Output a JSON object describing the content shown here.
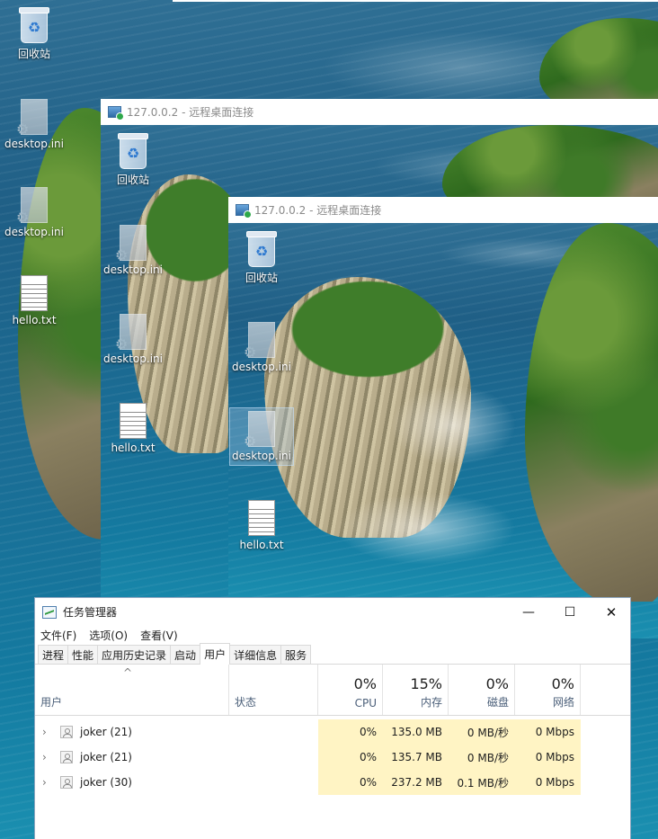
{
  "desktop": {
    "icons": [
      {
        "label": "回收站",
        "type": "recycle-bin"
      },
      {
        "label": "desktop.ini",
        "type": "ini-file"
      },
      {
        "label": "desktop.ini",
        "type": "ini-file"
      },
      {
        "label": "hello.txt",
        "type": "text-file"
      }
    ]
  },
  "rdp1": {
    "title": "127.0.0.2 - 远程桌面连接",
    "icons": [
      {
        "label": "回收站"
      },
      {
        "label": "desktop.ini"
      },
      {
        "label": "desktop.ini"
      },
      {
        "label": "hello.txt"
      }
    ]
  },
  "rdp2": {
    "title": "127.0.0.2 - 远程桌面连接",
    "icons": [
      {
        "label": "回收站"
      },
      {
        "label": "desktop.ini"
      },
      {
        "label": "desktop.ini",
        "selected": true
      },
      {
        "label": "hello.txt"
      }
    ]
  },
  "taskmgr": {
    "title": "任务管理器",
    "window_buttons": {
      "minimize": "—",
      "maximize": "☐",
      "close": "✕"
    },
    "menu": [
      "文件(F)",
      "选项(O)",
      "查看(V)"
    ],
    "tabs": [
      "进程",
      "性能",
      "应用历史记录",
      "启动",
      "用户",
      "详细信息",
      "服务"
    ],
    "active_tab": "用户",
    "headers": {
      "sort_indicator": "^",
      "user": "用户",
      "status": "状态",
      "cpu": {
        "pct": "0%",
        "name": "CPU"
      },
      "memory": {
        "pct": "15%",
        "name": "内存"
      },
      "disk": {
        "pct": "0%",
        "name": "磁盘"
      },
      "network": {
        "pct": "0%",
        "name": "网络"
      }
    },
    "rows": [
      {
        "user": "joker (21)",
        "status": "",
        "cpu": "0%",
        "memory": "135.0 MB",
        "disk": "0 MB/秒",
        "network": "0 Mbps"
      },
      {
        "user": "joker (21)",
        "status": "",
        "cpu": "0%",
        "memory": "135.7 MB",
        "disk": "0 MB/秒",
        "network": "0 Mbps"
      },
      {
        "user": "joker (30)",
        "status": "",
        "cpu": "0%",
        "memory": "237.2 MB",
        "disk": "0.1 MB/秒",
        "network": "0 Mbps"
      }
    ],
    "highlight_color": "#fff4c4"
  }
}
